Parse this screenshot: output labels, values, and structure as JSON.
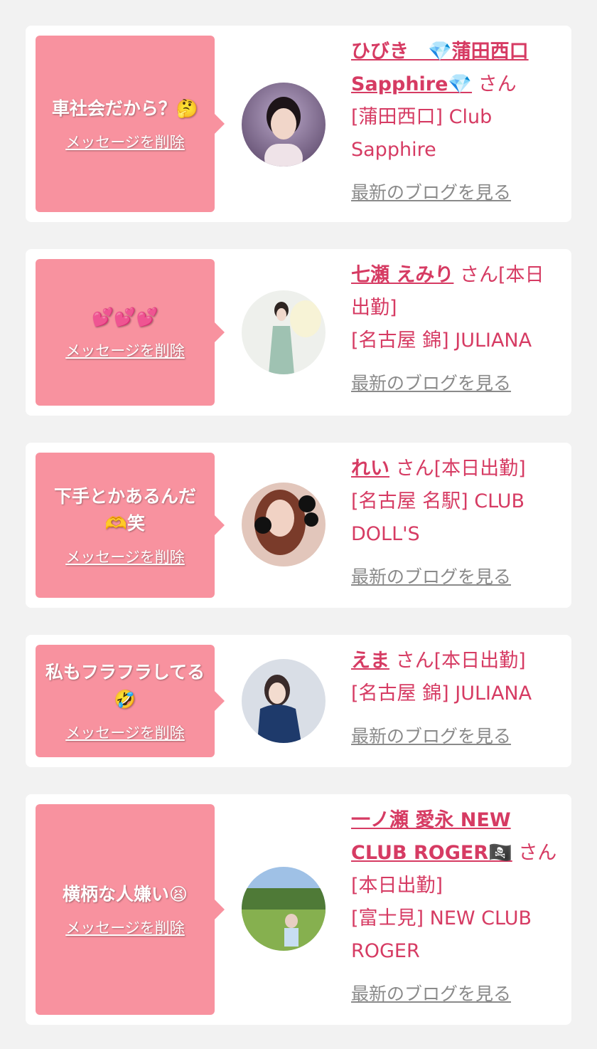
{
  "items": [
    {
      "message": "車社会だから？🤔",
      "delete_label": "メッセージを削除",
      "name": "ひびき　💎蒲田西口Sapphire💎",
      "san": "さん",
      "shop": "[蒲田西口] Club Sapphire",
      "blog_label": "最新のブログを見る"
    },
    {
      "message": "💕💕💕",
      "delete_label": "メッセージを削除",
      "name": "七瀬 えみり",
      "san": "さん[本日出勤]",
      "shop": "[名古屋 錦] JULIANA",
      "blog_label": "最新のブログを見る"
    },
    {
      "message": "下手とかあるんだ🫶笑",
      "delete_label": "メッセージを削除",
      "name": "れい",
      "san": "さん[本日出勤]",
      "shop": "[名古屋 名駅] CLUB DOLL'S",
      "blog_label": "最新のブログを見る"
    },
    {
      "message": "私もフラフラしてる🤣",
      "delete_label": "メッセージを削除",
      "name": "えま",
      "san": "さん[本日出勤]",
      "shop": "[名古屋 錦] JULIANA",
      "blog_label": "最新のブログを見る"
    },
    {
      "message": "横柄な人嫌い😫",
      "delete_label": "メッセージを削除",
      "name": "一ノ瀬 愛永 NEW CLUB ROGER🏴‍☠️",
      "san": "さん[本日出勤]",
      "shop": "[富士見] NEW CLUB ROGER",
      "blog_label": "最新のブログを見る"
    }
  ],
  "colors": {
    "bubble": "#f8929f",
    "link_text": "#d63b63",
    "blog_link": "#8a8a8a",
    "page_bg": "#f2f2f2"
  }
}
